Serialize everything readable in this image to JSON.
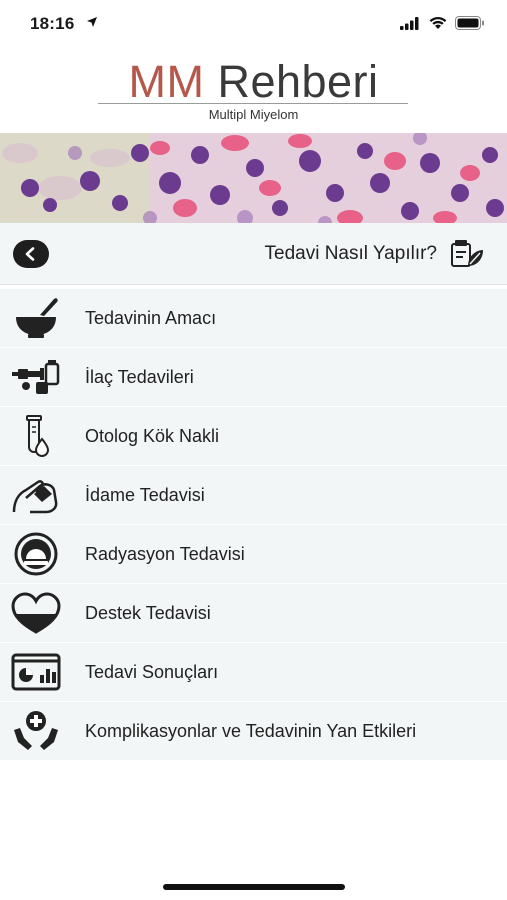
{
  "status_bar": {
    "time": "18:16"
  },
  "logo": {
    "brand_accent": "MM",
    "brand_rest": " Rehberi",
    "subtitle": "Multipl Miyelom"
  },
  "header": {
    "title": "Tedavi Nasıl Yapılır?"
  },
  "menu": {
    "items": [
      {
        "label": "Tedavinin Amacı",
        "icon": "mortar-pestle-icon"
      },
      {
        "label": "İlaç Tedavileri",
        "icon": "syringe-pills-icon"
      },
      {
        "label": "Otolog Kök Nakli",
        "icon": "test-tube-drop-icon"
      },
      {
        "label": "İdame Tedavisi",
        "icon": "hand-hold-icon"
      },
      {
        "label": "Radyasyon Tedavisi",
        "icon": "radiation-machine-icon"
      },
      {
        "label": "Destek Tedavisi",
        "icon": "heart-icon"
      },
      {
        "label": "Tedavi Sonuçları",
        "icon": "results-chart-icon"
      },
      {
        "label": "Komplikasyonlar ve Tedavinin Yan Etkileri",
        "icon": "medical-hands-icon"
      }
    ]
  },
  "colors": {
    "brand_accent": "#b5574a",
    "header_bg": "#f2f6f6",
    "menu_bg": "#f2f6f6",
    "text": "#222222"
  }
}
